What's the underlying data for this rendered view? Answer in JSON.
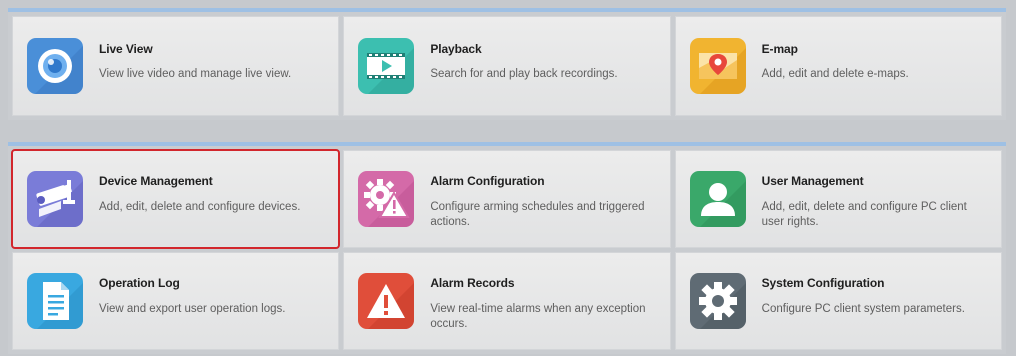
{
  "groups": [
    {
      "tiles": [
        {
          "key": "live-view",
          "title": "Live View",
          "desc": "View live video and manage live view.",
          "icon": "live-view-icon",
          "color": "#4a8fd8"
        },
        {
          "key": "playback",
          "title": "Playback",
          "desc": "Search for and play back recordings.",
          "icon": "playback-icon",
          "color": "#3cbfb0"
        },
        {
          "key": "e-map",
          "title": "E-map",
          "desc": "Add, edit and delete e-maps.",
          "icon": "e-map-icon",
          "color": "#f1b430"
        }
      ]
    },
    {
      "tiles": [
        {
          "key": "device-management",
          "title": "Device Management",
          "desc": "Add, edit, delete and configure devices.",
          "icon": "camera-icon",
          "color": "#7a7cd8",
          "selected": true
        },
        {
          "key": "alarm-configuration",
          "title": "Alarm Configuration",
          "desc": "Configure arming schedules and triggered actions.",
          "icon": "alarm-gear-icon",
          "color": "#d46aa8"
        },
        {
          "key": "user-management",
          "title": "User Management",
          "desc": "Add, edit, delete and configure PC client user rights.",
          "icon": "user-icon",
          "color": "#3aa86a"
        },
        {
          "key": "operation-log",
          "title": "Operation Log",
          "desc": "View and export user operation logs.",
          "icon": "document-icon",
          "color": "#39a8e0"
        },
        {
          "key": "alarm-records",
          "title": "Alarm Records",
          "desc": "View real-time alarms when any exception occurs.",
          "icon": "warning-icon",
          "color": "#e04e3a"
        },
        {
          "key": "system-configuration",
          "title": "System Configuration",
          "desc": "Configure PC client system parameters.",
          "icon": "settings-gear-icon",
          "color": "#5f6b74"
        }
      ]
    }
  ]
}
